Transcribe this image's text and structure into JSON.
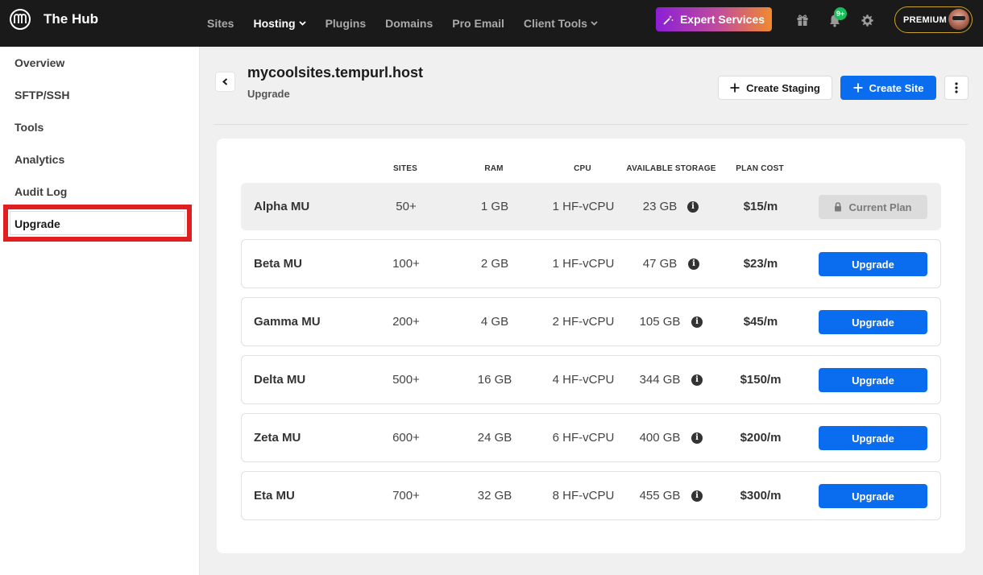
{
  "brand": {
    "name": "The Hub"
  },
  "nav": [
    {
      "label": "Sites",
      "active": false,
      "dropdown": false
    },
    {
      "label": "Hosting",
      "active": true,
      "dropdown": true
    },
    {
      "label": "Plugins",
      "active": false,
      "dropdown": false
    },
    {
      "label": "Domains",
      "active": false,
      "dropdown": false
    },
    {
      "label": "Pro Email",
      "active": false,
      "dropdown": false
    },
    {
      "label": "Client Tools",
      "active": false,
      "dropdown": true
    }
  ],
  "topbar": {
    "expert_label": "Expert Services",
    "notification_count": "9+",
    "premium_label": "PREMIUM"
  },
  "sidebar": {
    "items": [
      "Overview",
      "SFTP/SSH",
      "Tools",
      "Analytics",
      "Audit Log",
      "Upgrade"
    ],
    "selected": "Upgrade"
  },
  "header": {
    "site_title": "mycoolsites.tempurl.host",
    "subtitle": "Upgrade",
    "staging_label": "Create Staging",
    "create_label": "Create Site"
  },
  "table": {
    "columns": [
      "SITES",
      "RAM",
      "CPU",
      "AVAILABLE STORAGE",
      "PLAN COST"
    ],
    "rows": [
      {
        "name": "Alpha MU",
        "sites": "50+",
        "ram": "1 GB",
        "cpu": "1 HF-vCPU",
        "storage": "23 GB",
        "cost": "$15/m",
        "action": "Current Plan",
        "current": true
      },
      {
        "name": "Beta MU",
        "sites": "100+",
        "ram": "2 GB",
        "cpu": "1 HF-vCPU",
        "storage": "47 GB",
        "cost": "$23/m",
        "action": "Upgrade",
        "current": false
      },
      {
        "name": "Gamma MU",
        "sites": "200+",
        "ram": "4 GB",
        "cpu": "2 HF-vCPU",
        "storage": "105 GB",
        "cost": "$45/m",
        "action": "Upgrade",
        "current": false
      },
      {
        "name": "Delta MU",
        "sites": "500+",
        "ram": "16 GB",
        "cpu": "4 HF-vCPU",
        "storage": "344 GB",
        "cost": "$150/m",
        "action": "Upgrade",
        "current": false
      },
      {
        "name": "Zeta MU",
        "sites": "600+",
        "ram": "24 GB",
        "cpu": "6 HF-vCPU",
        "storage": "400 GB",
        "cost": "$200/m",
        "action": "Upgrade",
        "current": false
      },
      {
        "name": "Eta MU",
        "sites": "700+",
        "ram": "32 GB",
        "cpu": "8 HF-vCPU",
        "storage": "455 GB",
        "cost": "$300/m",
        "action": "Upgrade",
        "current": false
      }
    ]
  },
  "colors": {
    "topbar": "#1a1a1a",
    "primary_blue": "#0a6df0",
    "highlight_red": "#e02020",
    "notification_green": "#1abc5b"
  },
  "icons": [
    "hub-logo-icon",
    "magic-wand-icon",
    "gift-icon",
    "bell-icon",
    "gear-icon",
    "back-arrow-icon",
    "plus-icon",
    "more-vertical-icon",
    "info-icon",
    "lock-icon"
  ]
}
